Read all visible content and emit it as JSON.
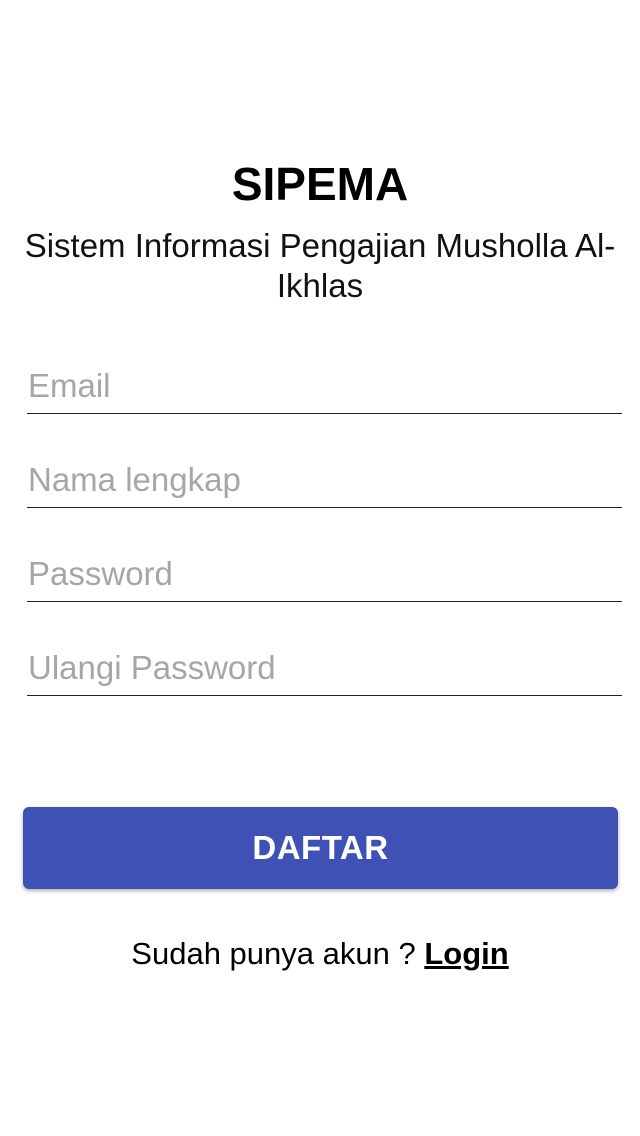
{
  "app": {
    "title": "SIPEMA",
    "subtitle": "Sistem Informasi Pengajian Musholla Al-Ikhlas"
  },
  "form": {
    "email_placeholder": "Email",
    "email_value": "",
    "name_placeholder": "Nama lengkap",
    "name_value": "",
    "password_placeholder": "Password",
    "password_value": "",
    "confirm_password_placeholder": "Ulangi Password",
    "confirm_password_value": ""
  },
  "actions": {
    "register_label": "DAFTAR",
    "have_account_text": "Sudah punya akun ?",
    "login_link": "Login"
  },
  "colors": {
    "primary": "#3f51b5",
    "placeholder": "#a6a6a6",
    "background": "#ffffff"
  }
}
